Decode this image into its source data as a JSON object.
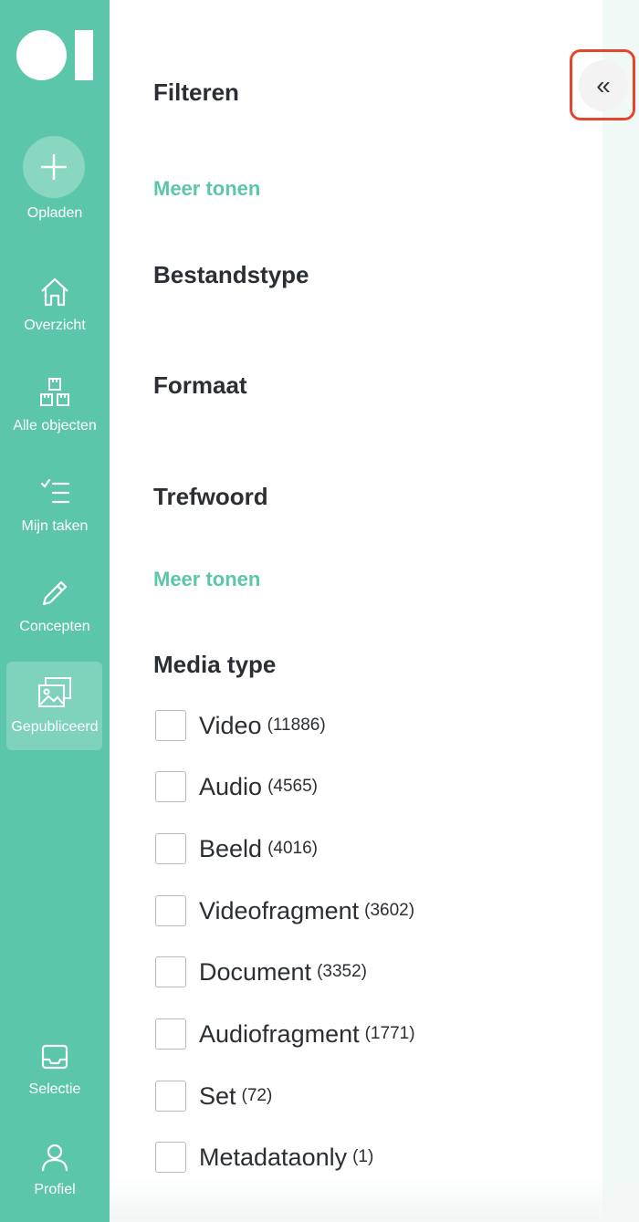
{
  "sidebar": {
    "upload_label": "Opladen",
    "items": [
      {
        "label": "Overzicht",
        "icon": "home-icon"
      },
      {
        "label": "Alle objecten",
        "icon": "boxes-icon"
      },
      {
        "label": "Mijn taken",
        "icon": "tasks-icon"
      },
      {
        "label": "Concepten",
        "icon": "pencil-icon"
      },
      {
        "label": "Gepubliceerd",
        "icon": "images-icon",
        "active": true
      }
    ],
    "bottom_items": [
      {
        "label": "Selectie",
        "icon": "inbox-icon"
      },
      {
        "label": "Profiel",
        "icon": "user-icon"
      }
    ]
  },
  "filter_panel": {
    "title": "Filteren",
    "collapse_icon": "«",
    "more_link_1": "Meer tonen",
    "section_filetype": "Bestandstype",
    "section_format": "Formaat",
    "section_keyword": "Trefwoord",
    "more_link_2": "Meer tonen",
    "section_media_type": "Media type",
    "media_types": [
      {
        "label": "Video",
        "count": "(11886)"
      },
      {
        "label": "Audio",
        "count": "(4565)"
      },
      {
        "label": "Beeld",
        "count": "(4016)"
      },
      {
        "label": "Videofragment",
        "count": "(3602)"
      },
      {
        "label": "Document",
        "count": "(3352)"
      },
      {
        "label": "Audiofragment",
        "count": "(1771)"
      },
      {
        "label": "Set",
        "count": "(72)"
      },
      {
        "label": "Metadataonly",
        "count": "(1)"
      }
    ]
  },
  "colors": {
    "brand": "#5cc6aa",
    "highlight": "#e5452e",
    "text": "#2b2f33"
  }
}
